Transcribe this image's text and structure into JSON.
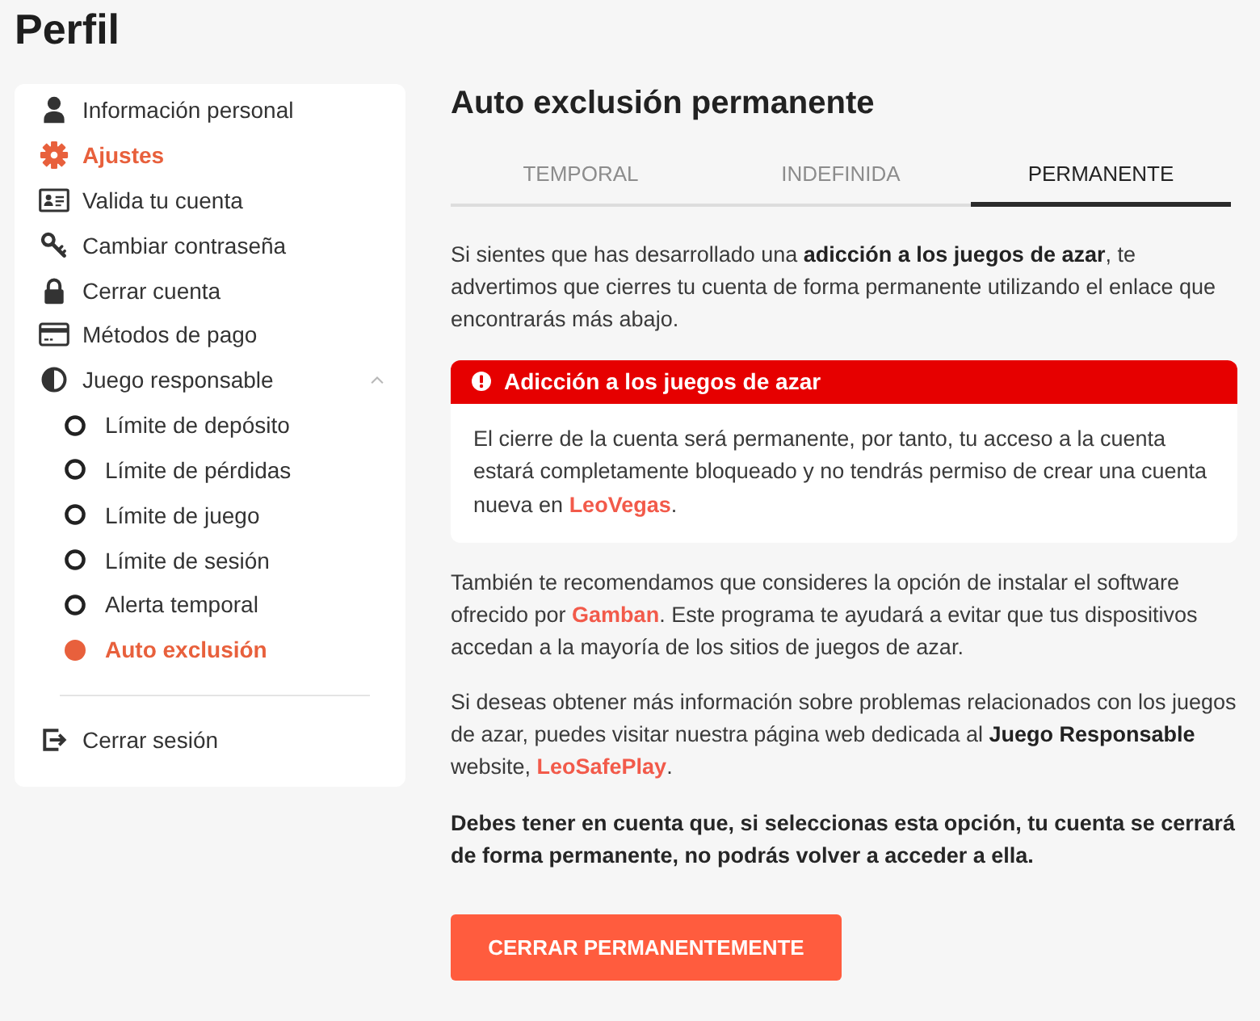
{
  "page": {
    "title": "Perfil"
  },
  "sidebar": {
    "items": [
      {
        "label": "Información personal",
        "selected": false
      },
      {
        "label": "Ajustes",
        "selected": true
      },
      {
        "label": "Valida tu cuenta",
        "selected": false
      },
      {
        "label": "Cambiar contraseña",
        "selected": false
      },
      {
        "label": "Cerrar cuenta",
        "selected": false
      },
      {
        "label": "Métodos de pago",
        "selected": false
      },
      {
        "label": "Juego responsable",
        "selected": false,
        "expanded": true,
        "children": [
          {
            "label": "Límite de depósito",
            "selected": false
          },
          {
            "label": "Límite de pérdidas",
            "selected": false
          },
          {
            "label": "Límite de juego",
            "selected": false
          },
          {
            "label": "Límite de sesión",
            "selected": false
          },
          {
            "label": "Alerta temporal",
            "selected": false
          },
          {
            "label": "Auto exclusión",
            "selected": true
          }
        ]
      }
    ],
    "logout": {
      "label": "Cerrar sesión"
    }
  },
  "main": {
    "title": "Auto exclusión permanente",
    "tabs": [
      {
        "label": "TEMPORAL",
        "selected": false
      },
      {
        "label": "INDEFINIDA",
        "selected": false
      },
      {
        "label": "PERMANENTE",
        "selected": true
      }
    ],
    "blocks": [
      {
        "kind": "paragraph",
        "strong": false,
        "parts": [
          {
            "kind": "text",
            "text": "Si sientes que has desarrollado una **adicción a los juegos de azar**, te advertimos que cierres tu cuenta de forma permanente utilizando el enlace que encontrarás más abajo."
          }
        ]
      },
      {
        "kind": "alert",
        "title": "Adicción a los juegos de azar",
        "parts": [
          {
            "kind": "text",
            "text": "El cierre de la cuenta será permanente, por tanto, tu acceso a la cuenta estará completamente bloqueado y no tendrás permiso de crear una cuenta nueva en "
          },
          {
            "kind": "link",
            "text": "LeoVegas"
          },
          {
            "kind": "text",
            "text": "."
          }
        ]
      },
      {
        "kind": "paragraph",
        "strong": false,
        "parts": [
          {
            "kind": "text",
            "text": "También te recomendamos que consideres la opción de instalar el software ofrecido por "
          },
          {
            "kind": "link",
            "text": "Gamban"
          },
          {
            "kind": "text",
            "text": ". Este programa te ayudará a evitar que tus dispositivos accedan a la mayoría de los sitios de juegos de azar."
          }
        ]
      },
      {
        "kind": "paragraph",
        "strong": false,
        "parts": [
          {
            "kind": "text",
            "text": "Si deseas obtener más información sobre problemas relacionados con los juegos de azar, puedes visitar nuestra página web dedicada al **Juego Responsable** website, "
          },
          {
            "kind": "link",
            "text": "LeoSafePlay"
          },
          {
            "kind": "text",
            "text": "."
          }
        ]
      },
      {
        "kind": "paragraph",
        "strong": true,
        "parts": [
          {
            "kind": "text",
            "text": "Debes tener en cuenta que, si seleccionas esta opción, tu cuenta se cerrará de forma permanente, no podrás volver a acceder a ella."
          }
        ]
      }
    ],
    "button": {
      "label": "CERRAR PERMANENTEMENTE"
    }
  }
}
